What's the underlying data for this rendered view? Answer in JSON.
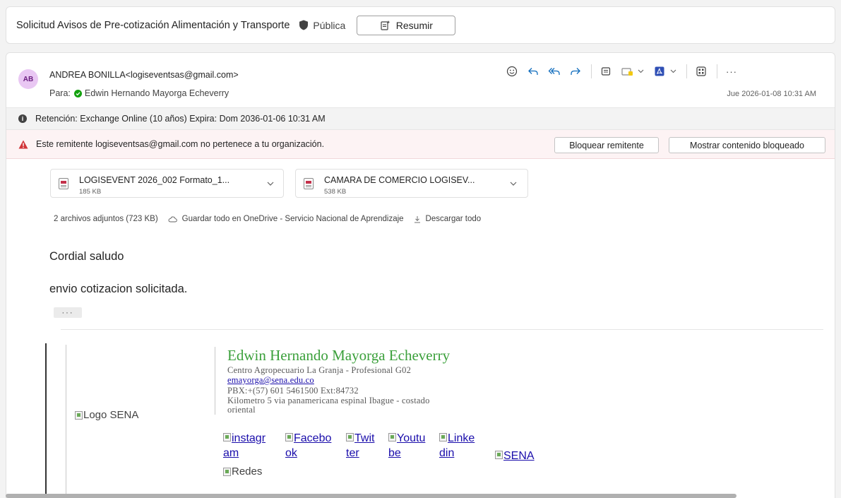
{
  "subject": {
    "title": "Solicitud Avisos de Pre-cotización Alimentación y Transporte",
    "sensitivity": "Pública",
    "summarize_label": "Resumir"
  },
  "message": {
    "avatar_initials": "AB",
    "sender": "ANDREA BONILLA<logiseventsas@gmail.com>",
    "to_prefix": "Para:",
    "to_name": "Edwin Hernando Mayorga Echeverry",
    "date": "Jue 2026-01-08 10:31 AM",
    "actions": [
      "emoji-icon",
      "reply-icon",
      "reply-all-icon",
      "forward-icon",
      "immersive-reader-icon",
      "move-icon",
      "acrobat-icon",
      "apps-icon",
      "more-icon"
    ],
    "more_label": "···"
  },
  "retention": {
    "icon": "i",
    "text": "Retención: Exchange Online (10 años) Expira: Dom 2036-01-06 10:31 AM"
  },
  "warning": {
    "text": "Este remitente logiseventsas@gmail.com no pertenece a tu organización.",
    "block_label": "Bloquear remitente",
    "show_label": "Mostrar contenido bloqueado"
  },
  "attachments": [
    {
      "name": "LOGISEVENT 2026_002 Formato_1...",
      "size": "185 KB"
    },
    {
      "name": "CAMARA DE COMERCIO LOGISEV...",
      "size": "538 KB"
    }
  ],
  "attachment_summary": {
    "count": "2 archivos adjuntos (723 KB)",
    "save_all": "Guardar todo en OneDrive - Servicio Nacional de Aprendizaje",
    "download_all": "Descargar todo"
  },
  "body": {
    "greeting": "Cordial saludo",
    "line1": "envio cotizacion solicitada.",
    "ellipsis": "···"
  },
  "signature": {
    "logo_alt": "Logo SENA",
    "name": "Edwin Hernando Mayorga Echeverry",
    "role": "Centro Agropecuario La Granja - Profesional G02",
    "email": "emayorga@sena.edu.co",
    "phone": "PBX:+(57) 601 5461500 Ext:84732",
    "address1": "Kilometro 5 via panamericana espinal Ibague - costado",
    "address2": "oriental",
    "social": [
      {
        "line1": "instagr",
        "line2": "am"
      },
      {
        "line1": "Facebo",
        "line2": "ok"
      },
      {
        "line1": "Twit",
        "line2": "ter"
      },
      {
        "line1": "Youtu",
        "line2": "be"
      },
      {
        "line1": "Linke",
        "line2": "din"
      }
    ],
    "sena_link": "SENA",
    "redes_alt": "Redes"
  },
  "colors": {
    "accent": "#0f6cbd",
    "online": "#13a10e",
    "warning": "#d13438",
    "signature_name": "#3ba03b",
    "link": "#1a0dab"
  }
}
